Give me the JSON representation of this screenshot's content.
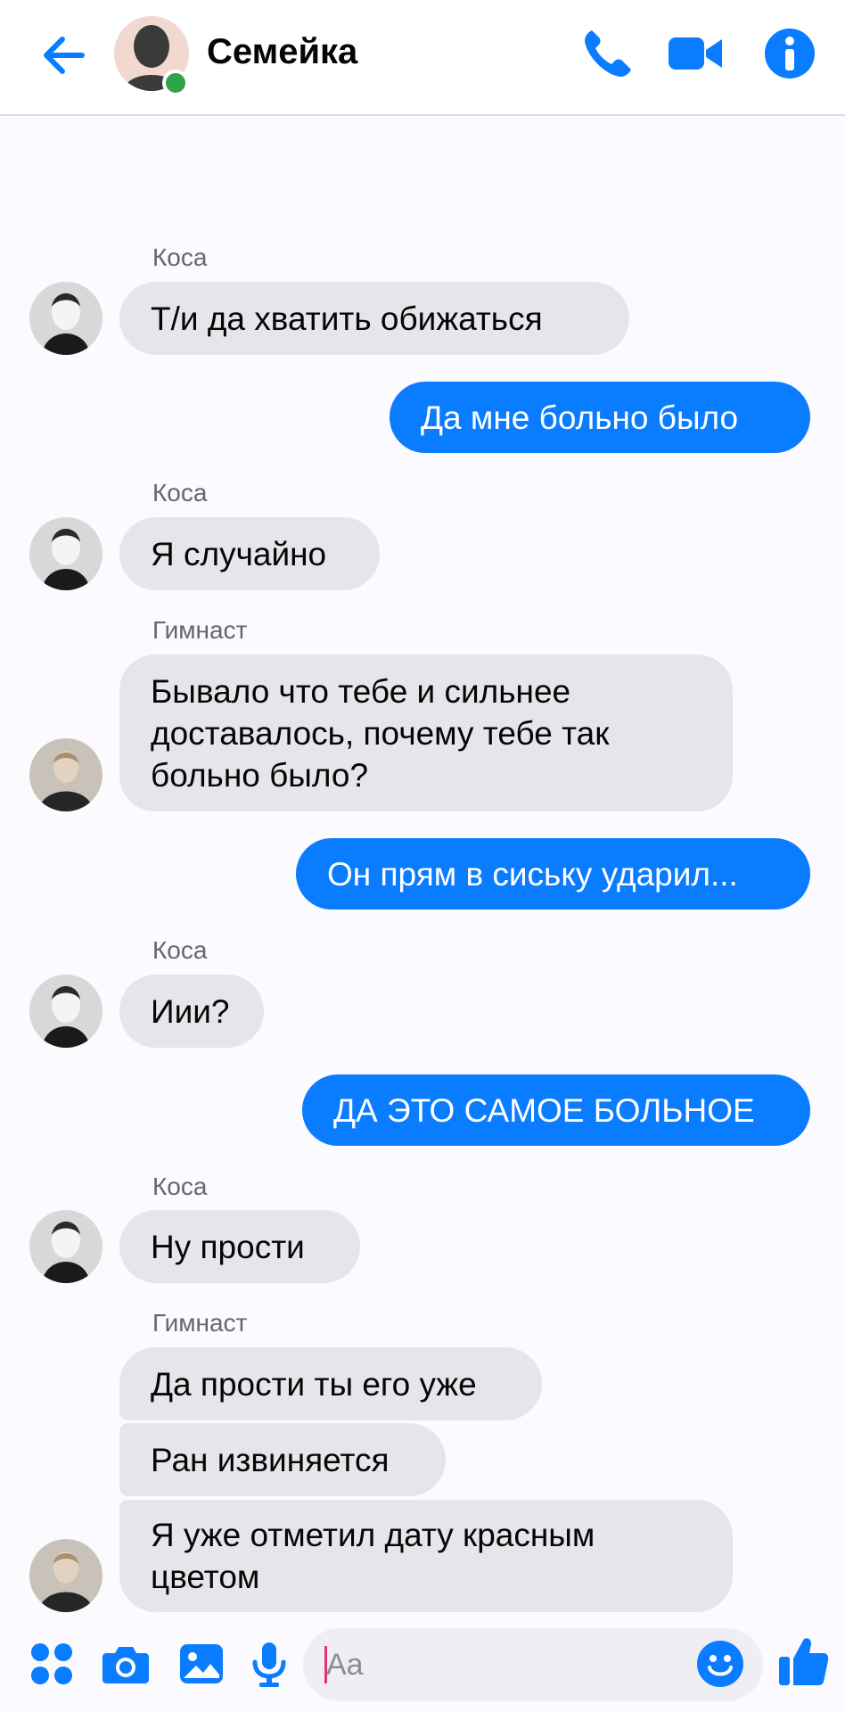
{
  "header": {
    "title": "Семейка",
    "icons": [
      "back-arrow-icon",
      "group-avatar",
      "phone-icon",
      "video-camera-icon",
      "info-icon"
    ]
  },
  "colors": {
    "accent": "#0a7cff",
    "incoming_bubble": "#e6e5ea",
    "online": "#31a24c"
  },
  "messages": [
    {
      "sender": "Коса",
      "text": "Т/и да хватить обижаться",
      "direction": "in"
    },
    {
      "text": "Да мне больно было",
      "direction": "out"
    },
    {
      "sender": "Коса",
      "text": "Я случайно",
      "direction": "in"
    },
    {
      "sender": "Гимнаст",
      "text": "Бывало что тебе и сильнее\nдоставалось, почему тебе так\nбольно было?",
      "direction": "in"
    },
    {
      "text": "Он прям в сиську ударил...",
      "direction": "out"
    },
    {
      "sender": "Коса",
      "text": "Иии?",
      "direction": "in"
    },
    {
      "text": "ДА ЭТО САМОЕ БОЛЬНОЕ",
      "direction": "out"
    },
    {
      "sender": "Коса",
      "text": "Ну прости",
      "direction": "in"
    },
    {
      "sender": "Гимнаст",
      "text": "Да прости ты его уже",
      "direction": "in"
    },
    {
      "text": "Ран извиняется",
      "direction": "in"
    },
    {
      "text": "Я уже отметил дату красным\nцветом",
      "direction": "in"
    }
  ],
  "composer": {
    "placeholder": "Aa",
    "icons": [
      "apps-grid-icon",
      "camera-icon",
      "gallery-icon",
      "microphone-icon",
      "emoji-icon",
      "thumbs-up-icon"
    ]
  }
}
